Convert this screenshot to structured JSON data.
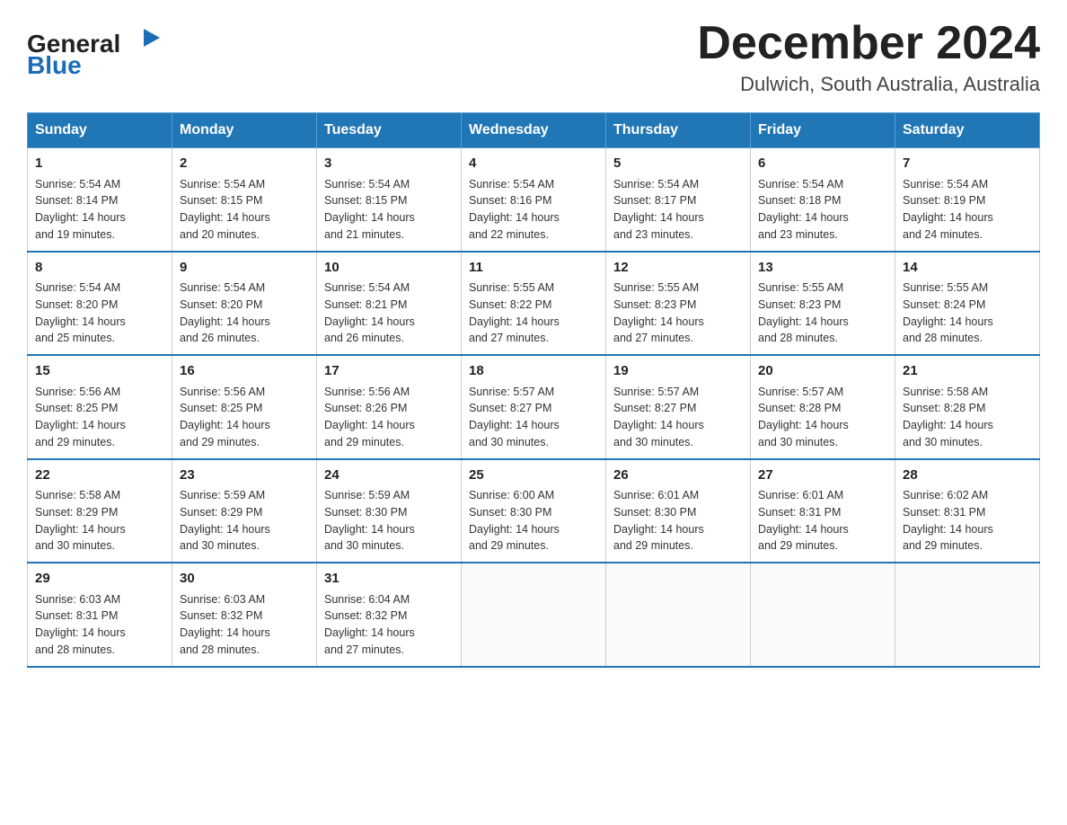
{
  "header": {
    "logo_text_general": "General",
    "logo_text_blue": "Blue",
    "month_title": "December 2024",
    "location": "Dulwich, South Australia, Australia"
  },
  "weekdays": [
    "Sunday",
    "Monday",
    "Tuesday",
    "Wednesday",
    "Thursday",
    "Friday",
    "Saturday"
  ],
  "weeks": [
    [
      {
        "day": "1",
        "sunrise": "5:54 AM",
        "sunset": "8:14 PM",
        "daylight": "14 hours and 19 minutes."
      },
      {
        "day": "2",
        "sunrise": "5:54 AM",
        "sunset": "8:15 PM",
        "daylight": "14 hours and 20 minutes."
      },
      {
        "day": "3",
        "sunrise": "5:54 AM",
        "sunset": "8:15 PM",
        "daylight": "14 hours and 21 minutes."
      },
      {
        "day": "4",
        "sunrise": "5:54 AM",
        "sunset": "8:16 PM",
        "daylight": "14 hours and 22 minutes."
      },
      {
        "day": "5",
        "sunrise": "5:54 AM",
        "sunset": "8:17 PM",
        "daylight": "14 hours and 23 minutes."
      },
      {
        "day": "6",
        "sunrise": "5:54 AM",
        "sunset": "8:18 PM",
        "daylight": "14 hours and 23 minutes."
      },
      {
        "day": "7",
        "sunrise": "5:54 AM",
        "sunset": "8:19 PM",
        "daylight": "14 hours and 24 minutes."
      }
    ],
    [
      {
        "day": "8",
        "sunrise": "5:54 AM",
        "sunset": "8:20 PM",
        "daylight": "14 hours and 25 minutes."
      },
      {
        "day": "9",
        "sunrise": "5:54 AM",
        "sunset": "8:20 PM",
        "daylight": "14 hours and 26 minutes."
      },
      {
        "day": "10",
        "sunrise": "5:54 AM",
        "sunset": "8:21 PM",
        "daylight": "14 hours and 26 minutes."
      },
      {
        "day": "11",
        "sunrise": "5:55 AM",
        "sunset": "8:22 PM",
        "daylight": "14 hours and 27 minutes."
      },
      {
        "day": "12",
        "sunrise": "5:55 AM",
        "sunset": "8:23 PM",
        "daylight": "14 hours and 27 minutes."
      },
      {
        "day": "13",
        "sunrise": "5:55 AM",
        "sunset": "8:23 PM",
        "daylight": "14 hours and 28 minutes."
      },
      {
        "day": "14",
        "sunrise": "5:55 AM",
        "sunset": "8:24 PM",
        "daylight": "14 hours and 28 minutes."
      }
    ],
    [
      {
        "day": "15",
        "sunrise": "5:56 AM",
        "sunset": "8:25 PM",
        "daylight": "14 hours and 29 minutes."
      },
      {
        "day": "16",
        "sunrise": "5:56 AM",
        "sunset": "8:25 PM",
        "daylight": "14 hours and 29 minutes."
      },
      {
        "day": "17",
        "sunrise": "5:56 AM",
        "sunset": "8:26 PM",
        "daylight": "14 hours and 29 minutes."
      },
      {
        "day": "18",
        "sunrise": "5:57 AM",
        "sunset": "8:27 PM",
        "daylight": "14 hours and 30 minutes."
      },
      {
        "day": "19",
        "sunrise": "5:57 AM",
        "sunset": "8:27 PM",
        "daylight": "14 hours and 30 minutes."
      },
      {
        "day": "20",
        "sunrise": "5:57 AM",
        "sunset": "8:28 PM",
        "daylight": "14 hours and 30 minutes."
      },
      {
        "day": "21",
        "sunrise": "5:58 AM",
        "sunset": "8:28 PM",
        "daylight": "14 hours and 30 minutes."
      }
    ],
    [
      {
        "day": "22",
        "sunrise": "5:58 AM",
        "sunset": "8:29 PM",
        "daylight": "14 hours and 30 minutes."
      },
      {
        "day": "23",
        "sunrise": "5:59 AM",
        "sunset": "8:29 PM",
        "daylight": "14 hours and 30 minutes."
      },
      {
        "day": "24",
        "sunrise": "5:59 AM",
        "sunset": "8:30 PM",
        "daylight": "14 hours and 30 minutes."
      },
      {
        "day": "25",
        "sunrise": "6:00 AM",
        "sunset": "8:30 PM",
        "daylight": "14 hours and 29 minutes."
      },
      {
        "day": "26",
        "sunrise": "6:01 AM",
        "sunset": "8:30 PM",
        "daylight": "14 hours and 29 minutes."
      },
      {
        "day": "27",
        "sunrise": "6:01 AM",
        "sunset": "8:31 PM",
        "daylight": "14 hours and 29 minutes."
      },
      {
        "day": "28",
        "sunrise": "6:02 AM",
        "sunset": "8:31 PM",
        "daylight": "14 hours and 29 minutes."
      }
    ],
    [
      {
        "day": "29",
        "sunrise": "6:03 AM",
        "sunset": "8:31 PM",
        "daylight": "14 hours and 28 minutes."
      },
      {
        "day": "30",
        "sunrise": "6:03 AM",
        "sunset": "8:32 PM",
        "daylight": "14 hours and 28 minutes."
      },
      {
        "day": "31",
        "sunrise": "6:04 AM",
        "sunset": "8:32 PM",
        "daylight": "14 hours and 27 minutes."
      },
      null,
      null,
      null,
      null
    ]
  ],
  "labels": {
    "sunrise": "Sunrise:",
    "sunset": "Sunset:",
    "daylight": "Daylight:"
  }
}
